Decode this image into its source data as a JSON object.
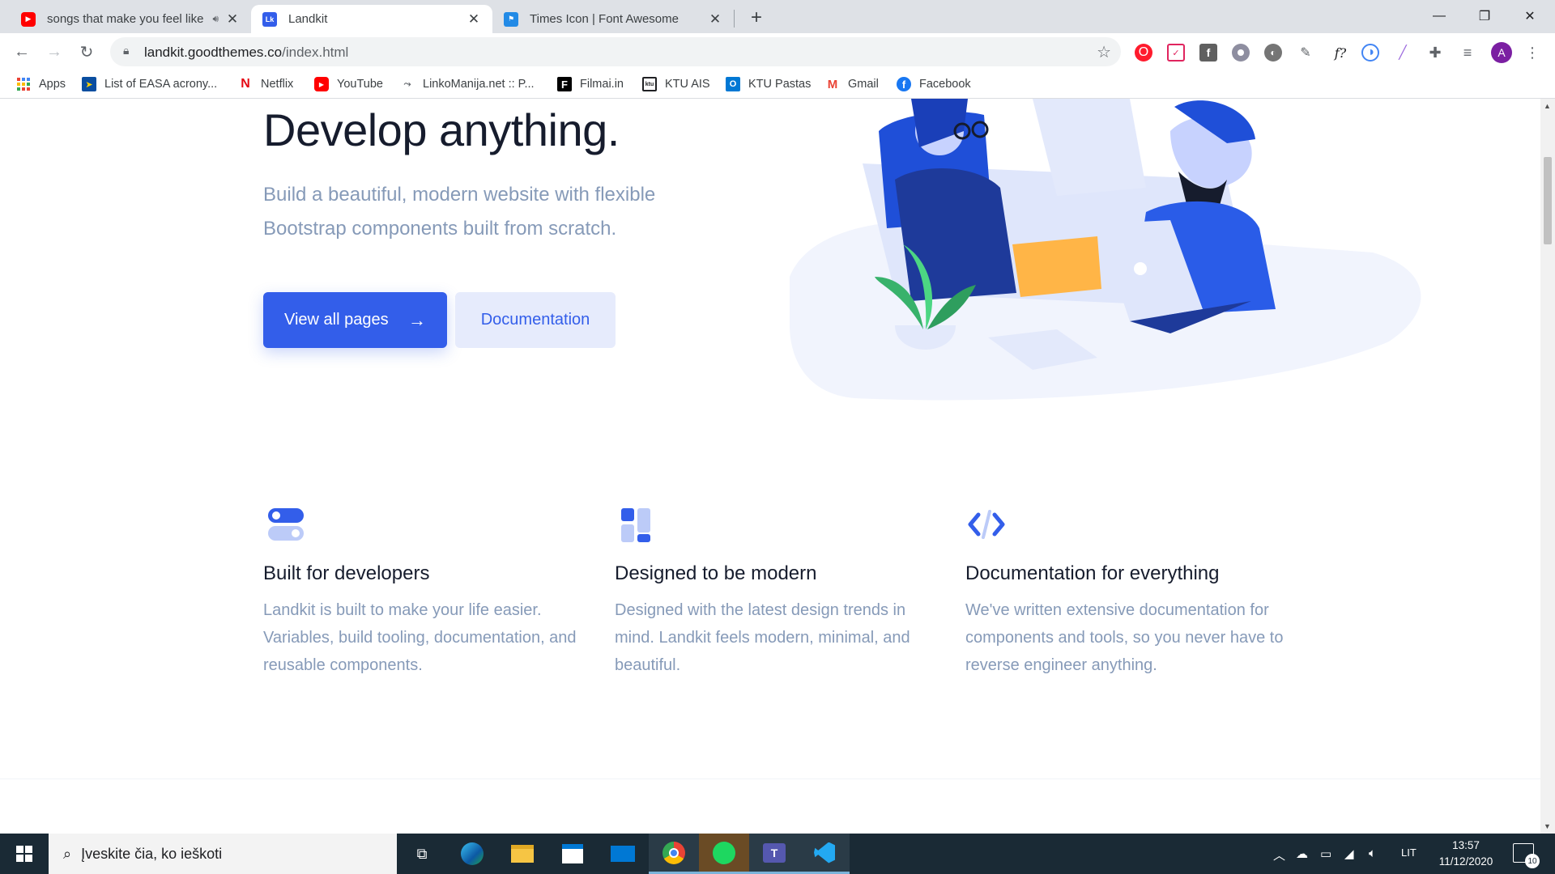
{
  "browser": {
    "tabs": [
      {
        "title": "songs that make you feel like",
        "favicon": "youtube-icon",
        "audio": true,
        "active": false
      },
      {
        "title": "Landkit",
        "favicon": "landkit-icon",
        "favicon_text": "Lk",
        "active": true
      },
      {
        "title": "Times Icon | Font Awesome",
        "favicon": "font-awesome-icon",
        "active": false
      }
    ],
    "new_tab": "+",
    "url_host": "landkit.goodthemes.co",
    "url_path": "/index.html",
    "bookmarks": [
      {
        "label": "Apps",
        "icon": "apps-grid-icon"
      },
      {
        "label": "List of EASA acrony...",
        "icon": "easa-icon"
      },
      {
        "label": "Netflix",
        "icon": "netflix-icon",
        "icon_text": "N"
      },
      {
        "label": "YouTube",
        "icon": "youtube-icon"
      },
      {
        "label": "LinkoManija.net :: P...",
        "icon": "linkomanija-icon"
      },
      {
        "label": "Filmai.in",
        "icon": "filmai-icon",
        "icon_text": "F"
      },
      {
        "label": "KTU AIS",
        "icon": "ktu-ais-icon",
        "icon_text": "ktu"
      },
      {
        "label": "KTU Pastas",
        "icon": "outlook-icon",
        "icon_text": "O"
      },
      {
        "label": "Gmail",
        "icon": "gmail-icon",
        "icon_text": "M"
      },
      {
        "label": "Facebook",
        "icon": "facebook-icon",
        "icon_text": "f"
      }
    ],
    "profile_initial": "A"
  },
  "hero": {
    "title": "Develop anything.",
    "lead": "Build a beautiful, modern website with flexible Bootstrap components built from scratch.",
    "primary_button": "View all pages",
    "primary_arrow": "→",
    "secondary_button": "Documentation"
  },
  "features": [
    {
      "icon": "toggle-icon",
      "title": "Built for developers",
      "text": "Landkit is built to make your life easier. Variables, build tooling, documentation, and reusable components."
    },
    {
      "icon": "layout-icon",
      "title": "Designed to be modern",
      "text": "Designed with the latest design trends in mind. Landkit feels modern, minimal, and beautiful."
    },
    {
      "icon": "code-icon",
      "title": "Documentation for everything",
      "text": "We've written extensive documentation for components and tools, so you never have to reverse engineer anything."
    }
  ],
  "taskbar": {
    "search_placeholder": "Įveskite čia, ko ieškoti",
    "language": "LIT",
    "time": "13:57",
    "date": "11/12/2020",
    "notifications": "10"
  },
  "colors": {
    "brand": "#335eea",
    "heading": "#161c2d",
    "muted": "#869ab8",
    "soft": "#e6ebfc"
  }
}
